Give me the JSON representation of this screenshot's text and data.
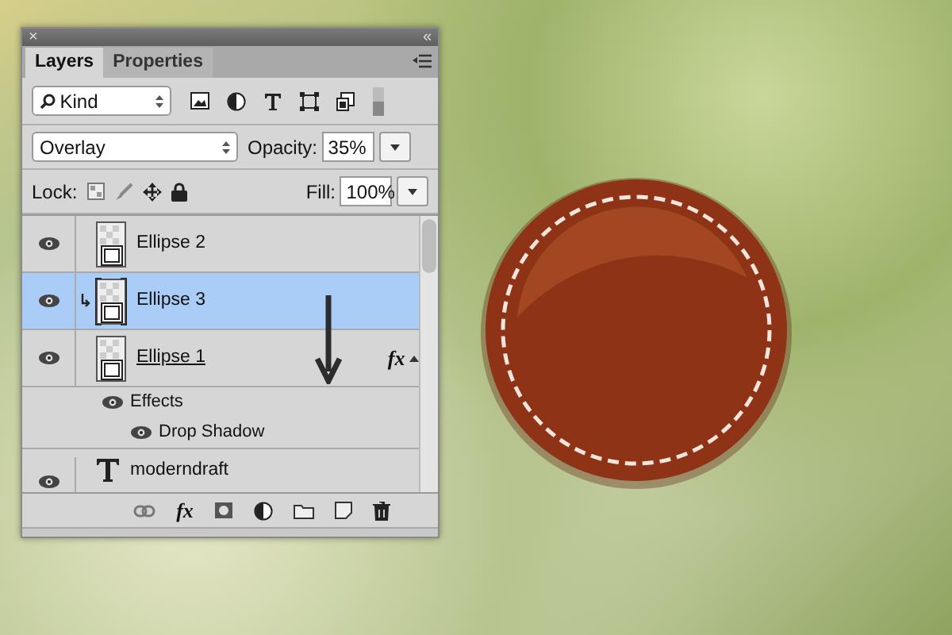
{
  "panel": {
    "close": "×",
    "collapse": "«",
    "tabs": [
      {
        "label": "Layers",
        "selected": true
      },
      {
        "label": "Properties",
        "selected": false
      }
    ],
    "toolbar": {
      "fx": "fx"
    },
    "filter": {
      "value": "Kind"
    },
    "blend_mode": {
      "value": "Overlay"
    },
    "opacity": {
      "label": "Opacity:",
      "value": "35%"
    },
    "lock": {
      "label": "Lock:"
    },
    "fill": {
      "label": "Fill:",
      "value": "100%"
    },
    "layers": [
      {
        "kind": "shape",
        "name": "Ellipse 2",
        "selected": false,
        "visible": true,
        "clipped": false,
        "underlined": false
      },
      {
        "kind": "shape",
        "name": "Ellipse 3",
        "selected": true,
        "visible": true,
        "clipped": true,
        "underlined": false
      },
      {
        "kind": "shape",
        "name": "Ellipse 1",
        "selected": false,
        "visible": true,
        "clipped": false,
        "underlined": true,
        "fx": "fx",
        "effects": {
          "label": "Effects",
          "items": [
            {
              "label": "Drop Shadow",
              "visible": true
            }
          ]
        }
      },
      {
        "kind": "text",
        "name": "moderndraft",
        "selected": false,
        "visible": true,
        "clipped": false,
        "underlined": false
      }
    ]
  }
}
